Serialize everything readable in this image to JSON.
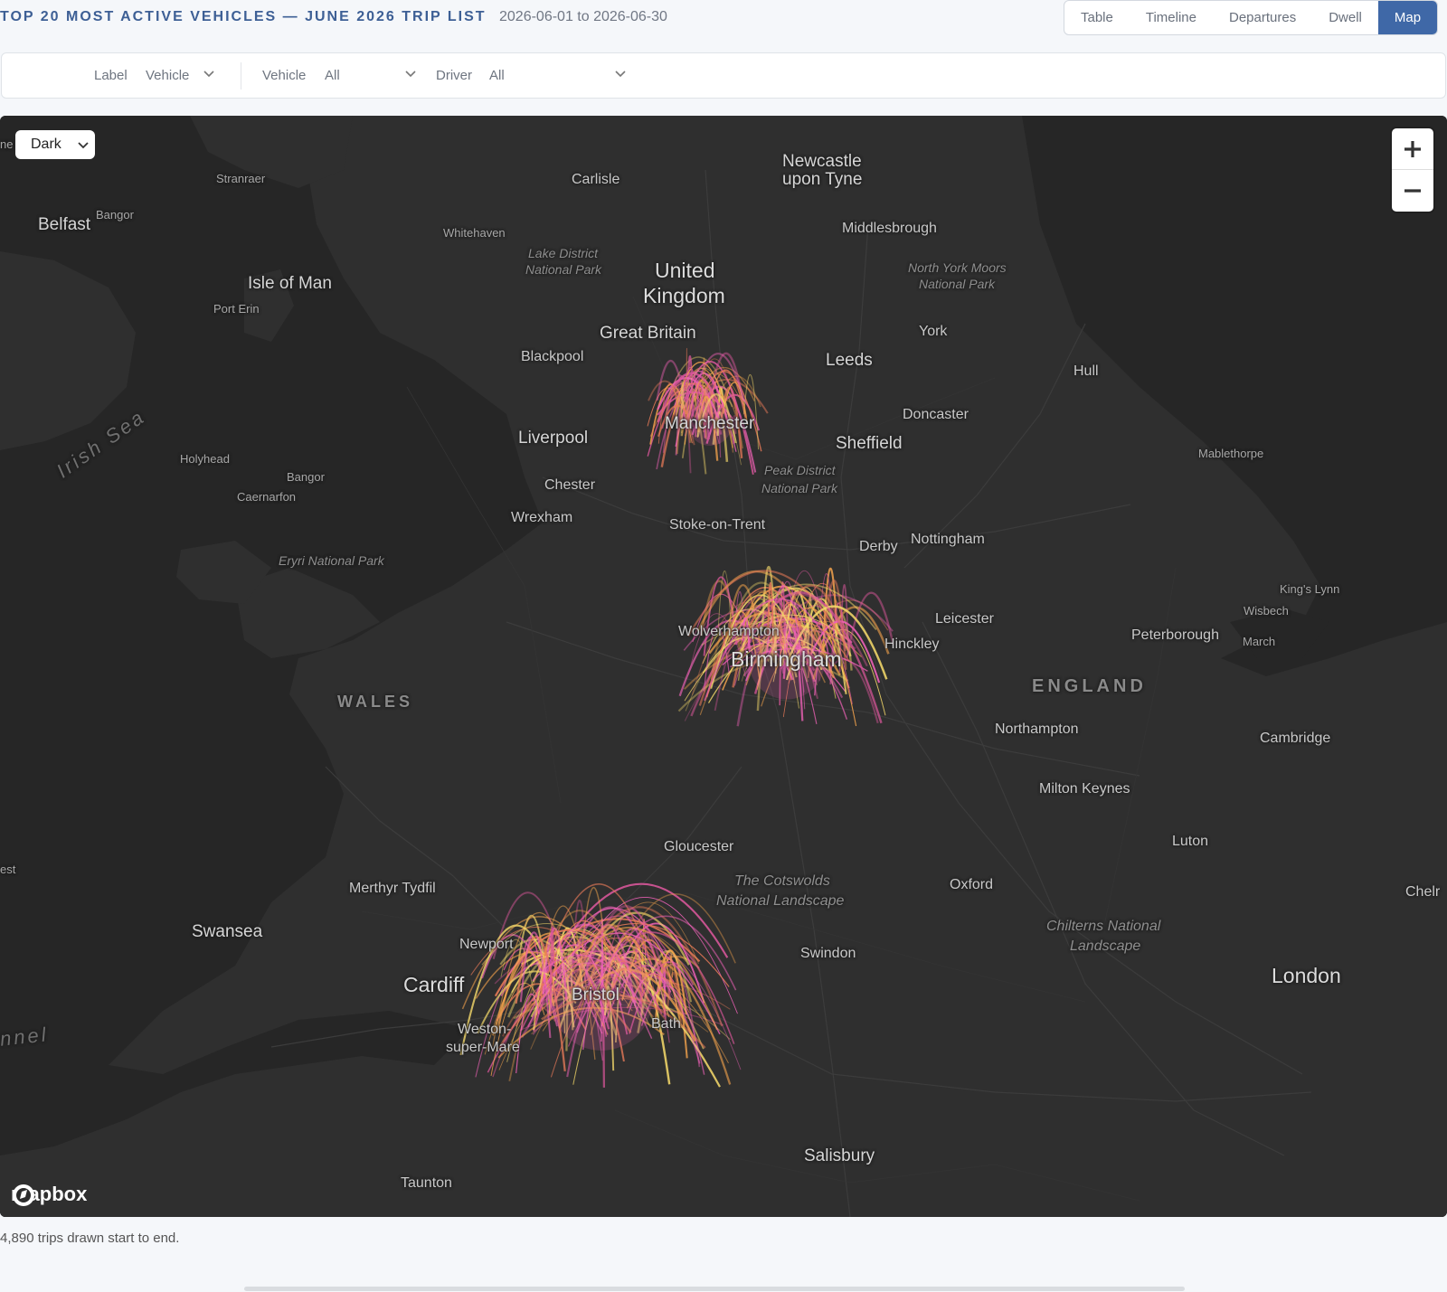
{
  "header": {
    "title": "TOP 20 MOST ACTIVE VEHICLES — JUNE 2026 TRIP LIST",
    "date_range": "2026-06-01 to 2026-06-30",
    "views": [
      "Table",
      "Timeline",
      "Departures",
      "Dwell",
      "Map"
    ],
    "active_view": "Map"
  },
  "filters": {
    "label_label": "Label",
    "label_value": "Vehicle",
    "vehicle_label": "Vehicle",
    "vehicle_value": "All",
    "driver_label": "Driver",
    "driver_value": "All"
  },
  "map": {
    "style_select": "Dark",
    "labels": {
      "newcastle_1": "Newcastle",
      "newcastle_2": "upon Tyne",
      "carlisle": "Carlisle",
      "stranraer": "Stranraer",
      "belfast": "Belfast",
      "bangor_ni": "Bangor",
      "whitehaven": "Whitehaven",
      "lake_district_1": "Lake District",
      "lake_district_2": "National Park",
      "united_kingdom_1": "United",
      "united_kingdom_2": "Kingdom",
      "middlesbrough": "Middlesbrough",
      "north_york_moors_1": "North York Moors",
      "north_york_moors_2": "National Park",
      "isle_of_man": "Isle of Man",
      "port_erin": "Port Erin",
      "great_britain": "Great Britain",
      "york": "York",
      "blackpool": "Blackpool",
      "leeds": "Leeds",
      "hull": "Hull",
      "doncaster": "Doncaster",
      "manchester": "Manchester",
      "liverpool": "Liverpool",
      "sheffield": "Sheffield",
      "mablethorpe": "Mablethorpe",
      "irish_sea": "Irish Sea",
      "holyhead": "Holyhead",
      "bangor_wales": "Bangor",
      "caernarfon": "Caernarfon",
      "chester": "Chester",
      "peak_district_1": "Peak District",
      "peak_district_2": "National Park",
      "wrexham": "Wrexham",
      "stoke": "Stoke-on-Trent",
      "derby": "Derby",
      "nottingham": "Nottingham",
      "eryri": "Eryri National Park",
      "kings_lynn": "King's Lynn",
      "wisbech": "Wisbech",
      "leicester": "Leicester",
      "wolverhampton": "Wolverhampton",
      "peterborough": "Peterborough",
      "march": "March",
      "hinckley": "Hinckley",
      "birmingham": "Birmingham",
      "england": "ENGLAND",
      "wales": "WALES",
      "northampton": "Northampton",
      "cambridge": "Cambridge",
      "milton_keynes": "Milton Keynes",
      "luton": "Luton",
      "gloucester": "Gloucester",
      "cotswolds_1": "The Cotswolds",
      "cotswolds_2": "National Landscape",
      "est": "est",
      "merthyr": "Merthyr Tydfil",
      "oxford": "Oxford",
      "chelm": "Chelr",
      "swansea": "Swansea",
      "chilterns_1": "Chilterns National",
      "chilterns_2": "Landscape",
      "newport": "Newport",
      "swindon": "Swindon",
      "cardiff": "Cardiff",
      "london": "London",
      "bristol": "Bristol",
      "bath": "Bath",
      "weston_1": "Weston-",
      "weston_2": "super-Mare",
      "channel": "nnel",
      "salisbury": "Salisbury",
      "taunton": "Taunton",
      "edge_ne": "ne"
    },
    "attribution": "mapbox",
    "zoom_in_icon": "plus-icon",
    "zoom_out_icon": "minus-icon",
    "arc_colors": [
      "#f3d86a",
      "#f2a24c",
      "#e77a58",
      "#d9569a",
      "#f062b8"
    ]
  },
  "footnote": "4,890 trips drawn start to end."
}
